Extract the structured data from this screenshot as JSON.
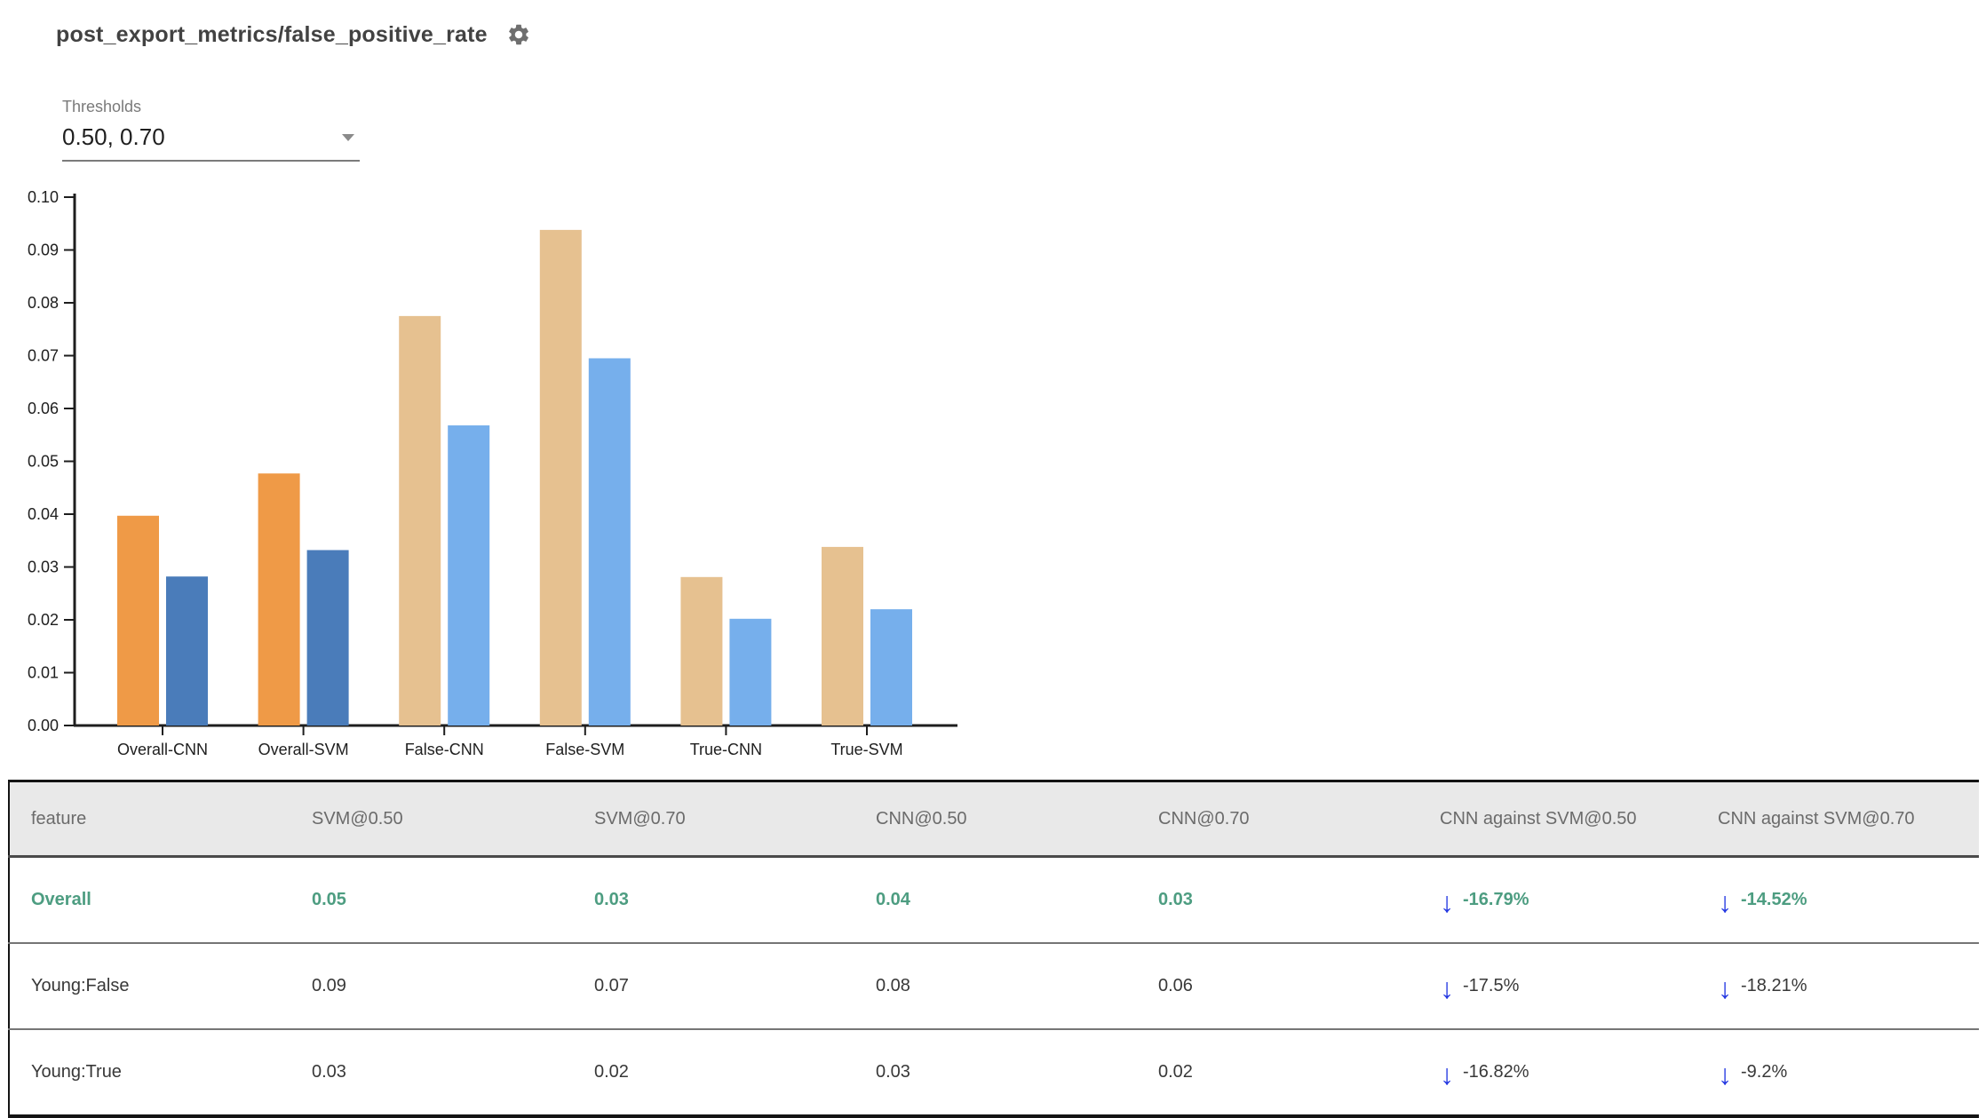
{
  "header": {
    "title": "post_export_metrics/false_positive_rate"
  },
  "controls": {
    "thresholds_label": "Thresholds",
    "thresholds_value": "0.50, 0.70"
  },
  "icons": {
    "settings": "gear-icon",
    "dropdown": "chevron-down-icon",
    "decrease": "down-arrow-icon",
    "decrease_glyph": "↓"
  },
  "chart_data": {
    "type": "bar",
    "title": "",
    "xlabel": "",
    "ylabel": "",
    "categories": [
      "Overall-CNN",
      "Overall-SVM",
      "False-CNN",
      "False-SVM",
      "True-CNN",
      "True-SVM"
    ],
    "series": [
      {
        "name": "threshold 0.50",
        "values": [
          0.0397,
          0.0477,
          0.0775,
          0.0938,
          0.0281,
          0.0338
        ]
      },
      {
        "name": "threshold 0.70",
        "values": [
          0.0282,
          0.0332,
          0.0568,
          0.0695,
          0.0202,
          0.022
        ]
      }
    ],
    "colors_by_category": [
      [
        "#EF9A47",
        "#4A7CBA"
      ],
      [
        "#EF9A47",
        "#4A7CBA"
      ],
      [
        "#E6C190",
        "#76AFEC"
      ],
      [
        "#E6C190",
        "#76AFEC"
      ],
      [
        "#E6C190",
        "#76AFEC"
      ],
      [
        "#E6C190",
        "#76AFEC"
      ]
    ],
    "ylim": [
      0,
      0.1
    ],
    "ytick_step": 0.01,
    "grid": false,
    "legend": "none"
  },
  "table": {
    "columns": [
      "feature",
      "SVM@0.50",
      "SVM@0.70",
      "CNN@0.50",
      "CNN@0.70",
      "CNN against SVM@0.50",
      "CNN against SVM@0.70"
    ],
    "rows": [
      {
        "feature": "Overall",
        "values": [
          "0.05",
          "0.03",
          "0.04",
          "0.03"
        ],
        "comparisons": [
          {
            "direction": "down",
            "text": "-16.79%"
          },
          {
            "direction": "down",
            "text": "-14.52%"
          }
        ],
        "highlight": true
      },
      {
        "feature": "Young:False",
        "values": [
          "0.09",
          "0.07",
          "0.08",
          "0.06"
        ],
        "comparisons": [
          {
            "direction": "down",
            "text": "-17.5%"
          },
          {
            "direction": "down",
            "text": "-18.21%"
          }
        ],
        "highlight": false
      },
      {
        "feature": "Young:True",
        "values": [
          "0.03",
          "0.02",
          "0.03",
          "0.02"
        ],
        "comparisons": [
          {
            "direction": "down",
            "text": "-16.82%"
          },
          {
            "direction": "down",
            "text": "-9.2%"
          }
        ],
        "highlight": false
      }
    ],
    "highlight_color": "#4D9D81",
    "arrow_color": "#2337E1",
    "header_bg": "#e9e9e9"
  }
}
